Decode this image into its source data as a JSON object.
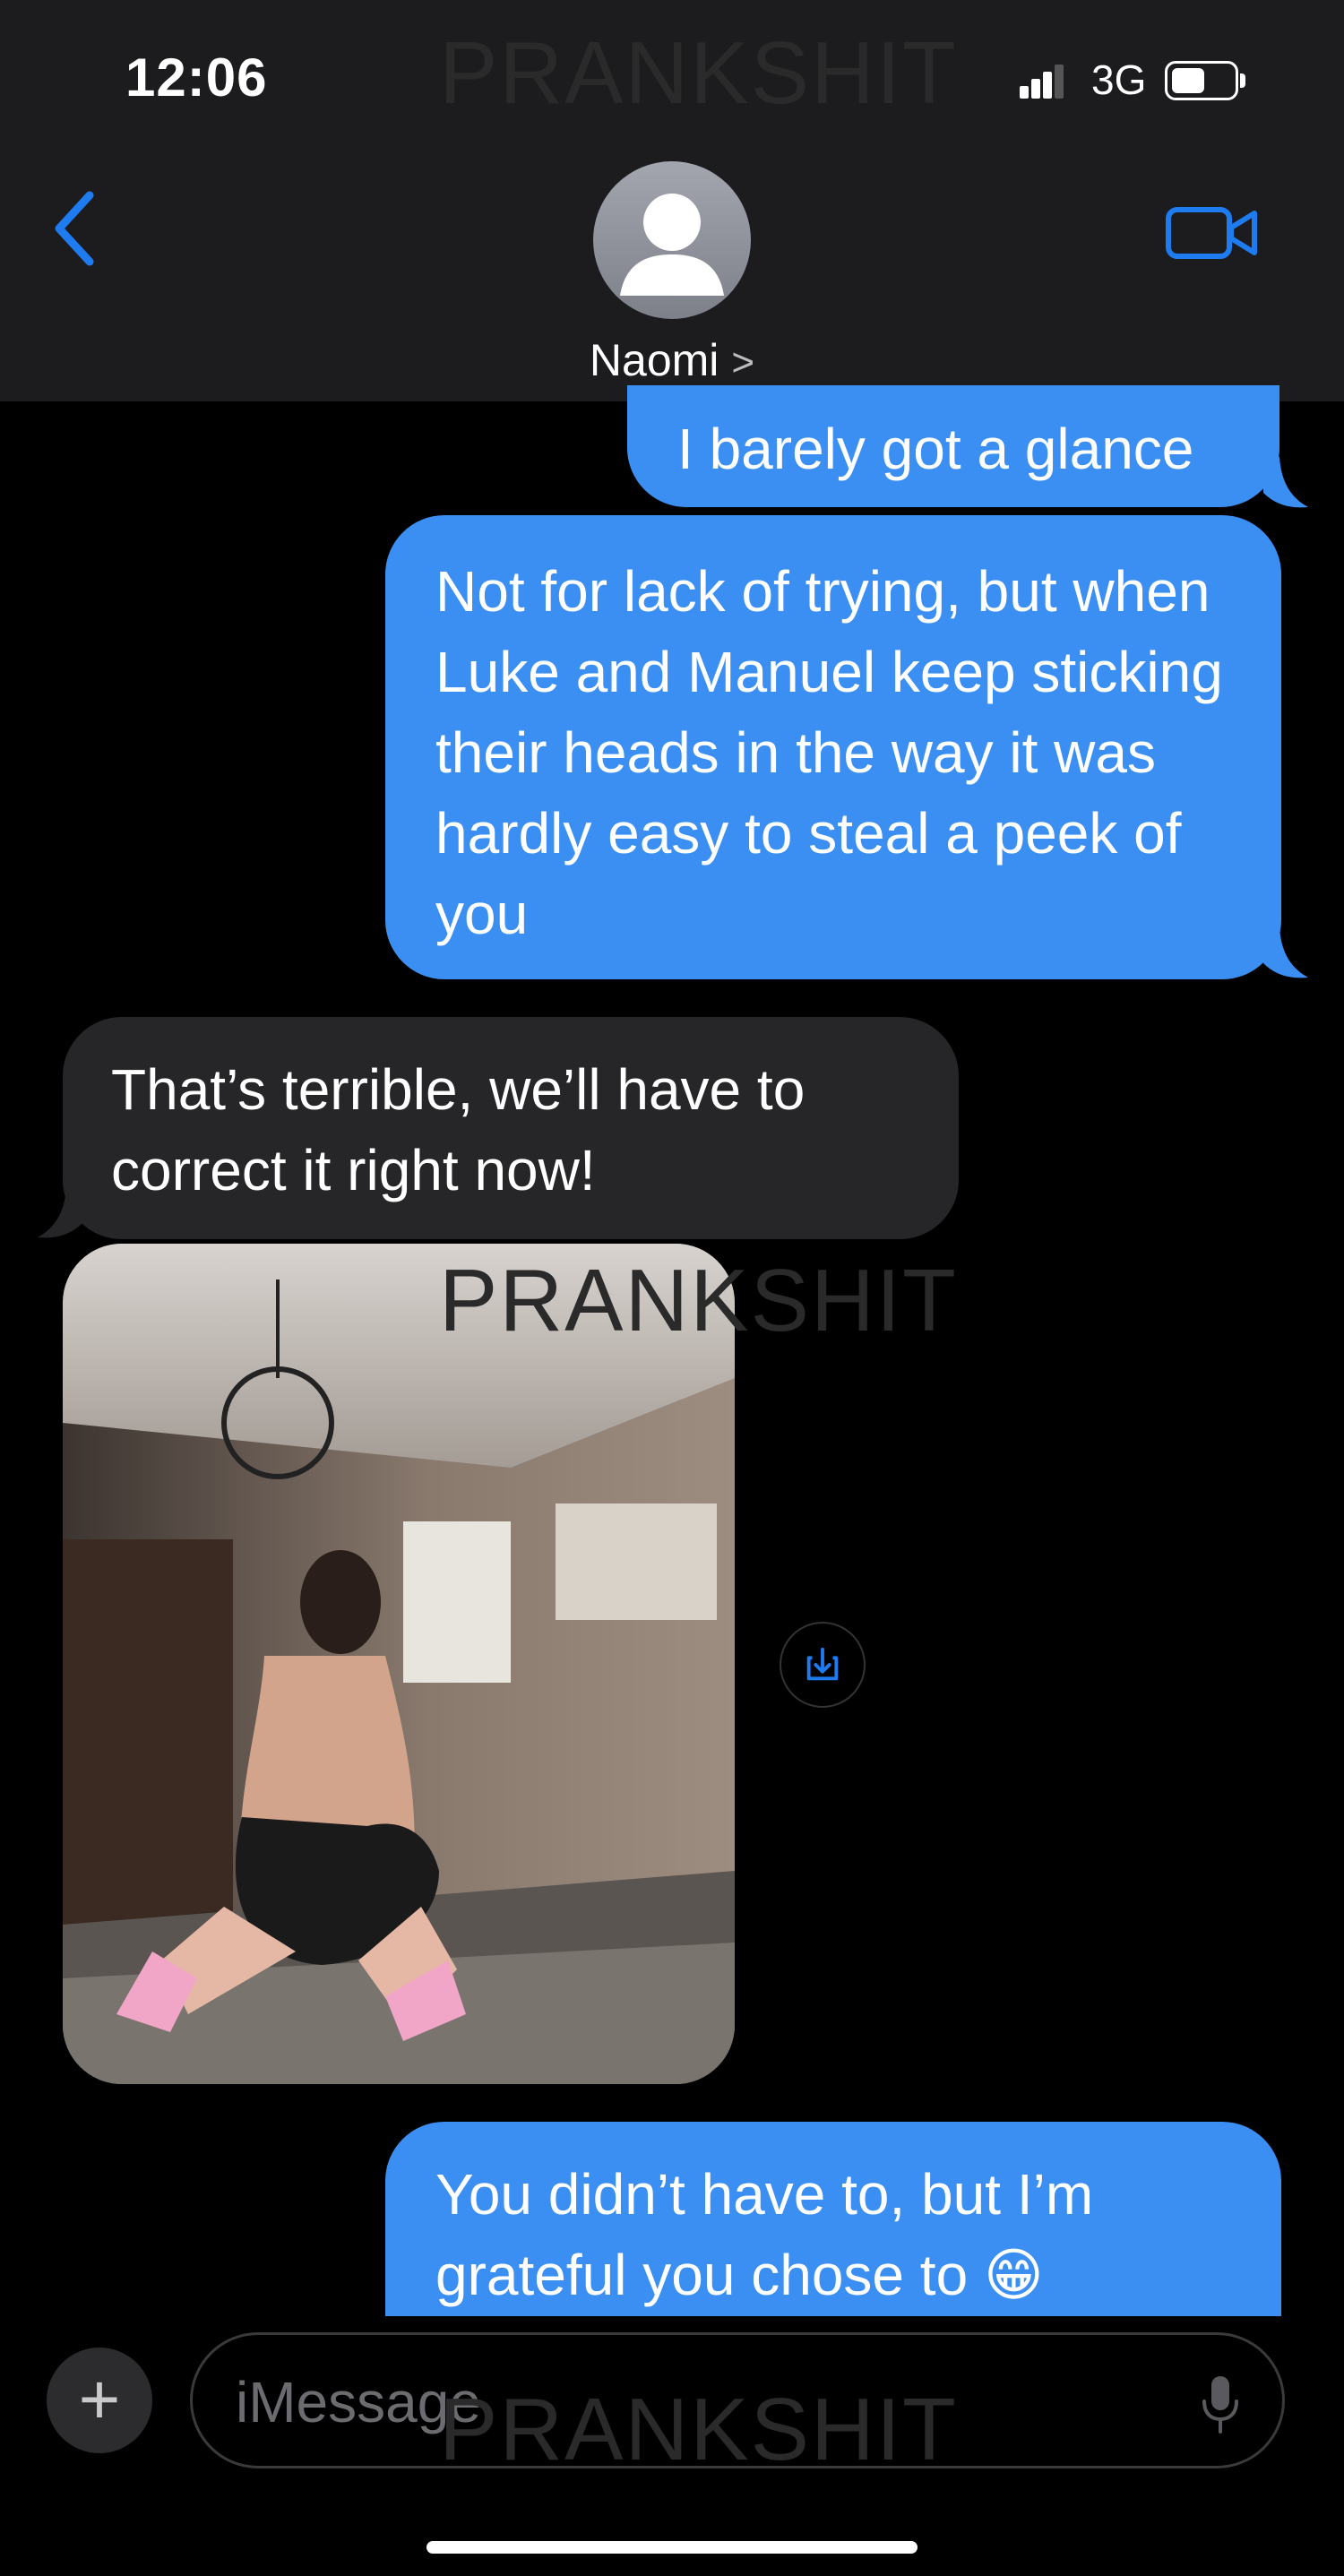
{
  "status_bar": {
    "time": "12:06",
    "network": "3G"
  },
  "header": {
    "contact_name": "Naomi",
    "chevron": ">"
  },
  "watermark": "PRANKSHIT",
  "messages": [
    {
      "from": "me",
      "text": "I barely got a glance"
    },
    {
      "from": "me",
      "text": "Not for lack of trying, but when Luke and Manuel keep sticking their heads in the way it was hardly easy to steal a peek of you"
    },
    {
      "from": "them",
      "text": "That’s terrible, we’ll have to correct it right now!"
    },
    {
      "from": "them",
      "type": "photo"
    },
    {
      "from": "me",
      "text": "You didn’t have to, but I’m grateful you chose to 😁"
    }
  ],
  "input": {
    "placeholder": "iMessage",
    "value": "",
    "plus": "+"
  },
  "icons": [
    "back-chevron-icon",
    "video-camera-icon",
    "person-icon",
    "download-icon",
    "microphone-icon",
    "signal-icon",
    "battery-icon"
  ],
  "colors": {
    "sent_bubble": "#3b8ff3",
    "received_bubble": "#262628",
    "accent": "#1e7cf0",
    "header_bg": "#1c1c1e"
  }
}
